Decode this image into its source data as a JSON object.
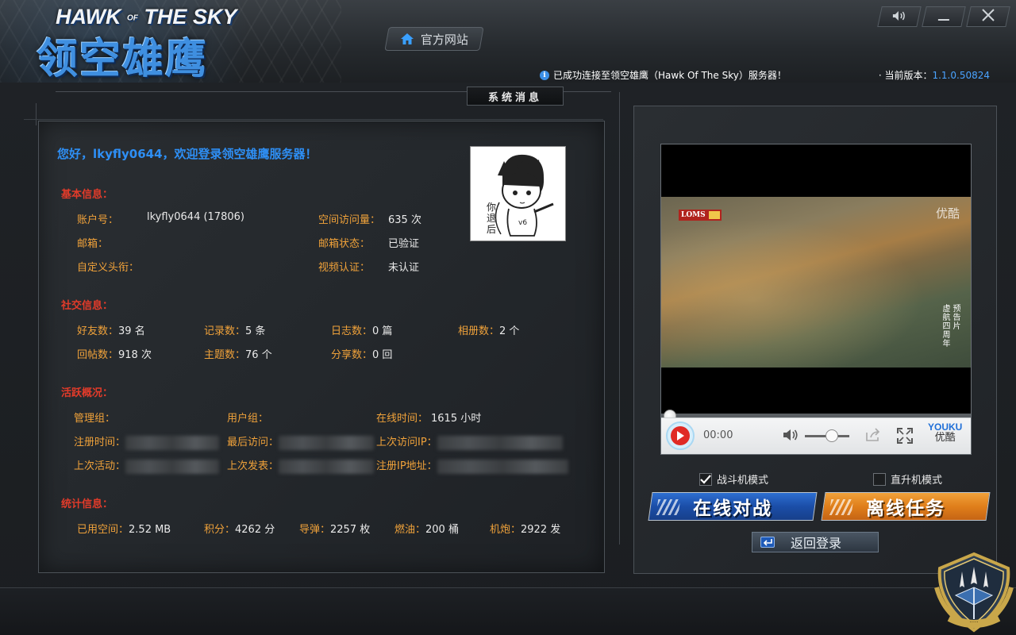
{
  "app": {
    "logo_en_part1": "HAWK",
    "logo_en_of": "OF",
    "logo_en_part2": "THE SKY",
    "logo_cn": "领空雄鹰"
  },
  "header": {
    "site_button": "官方网站",
    "status_message": "已成功连接至领空雄鹰（Hawk Of The Sky）服务器！",
    "version_label": "· 当前版本：",
    "version_value": "1.1.0.50824"
  },
  "tab": {
    "title": "系统消息"
  },
  "welcome": "您好，lkyfly0644，欢迎登录领空雄鹰服务器！",
  "basic": {
    "title": "基本信息：",
    "account_label": "账户号：",
    "account_value": "lkyfly0644 (17806)",
    "visits_label": "空间访问量：",
    "visits_value": "635 次",
    "email_label": "邮箱：",
    "email_value": "",
    "email_status_label": "邮箱状态：",
    "email_status_value": "已验证",
    "custom_avatar_label": "自定义头衔：",
    "custom_avatar_value": "",
    "video_auth_label": "视频认证：",
    "video_auth_value": "未认证"
  },
  "social": {
    "title": "社交信息：",
    "friends_label": "好友数：",
    "friends_value": "39 名",
    "records_label": "记录数：",
    "records_value": "5 条",
    "logs_label": "日志数：",
    "logs_value": "0 篇",
    "albums_label": "相册数：",
    "albums_value": "2 个",
    "replies_label": "回帖数：",
    "replies_value": "918 次",
    "topics_label": "主题数：",
    "topics_value": "76 个",
    "shares_label": "分享数：",
    "shares_value": "0 回"
  },
  "activity": {
    "title": "活跃概况：",
    "admin_group_label": "管理组：",
    "user_group_label": "用户组：",
    "online_time_label": "在线时间：",
    "online_time_value": "1615 小时",
    "reg_time_label": "注册时间：",
    "last_visit_label": "最后访问：",
    "last_ip_label": "上次访问IP：",
    "last_active_label": "上次活动：",
    "last_post_label": "上次发表：",
    "reg_ip_label": "注册IP地址："
  },
  "stats": {
    "title": "统计信息：",
    "space_label": "已用空间：",
    "space_value": "2.52 MB",
    "points_label": "积分：",
    "points_value": "4262 分",
    "missiles_label": "导弹：",
    "missiles_value": "2257 枚",
    "fuel_label": "燃油：",
    "fuel_value": "200 桶",
    "cannon_label": "机炮：",
    "cannon_value": "2922 发"
  },
  "video": {
    "badge": "LOMS",
    "watermark": "优酷",
    "caption_col1": "虚航四周年",
    "caption_col2": "预告片",
    "time": "00:00",
    "youku_en": "YOUKU",
    "youku_cn": "优酷",
    "progress_fraction": 0.0,
    "volume_fraction": 0.6
  },
  "modes": {
    "fighter_label": "战斗机模式",
    "fighter_checked": true,
    "heli_label": "直升机模式",
    "heli_checked": false
  },
  "buttons": {
    "online": "在线对战",
    "offline": "离线任务",
    "back": "返回登录"
  },
  "colors": {
    "accent_blue": "#2e8ff5",
    "section_red": "#e23b2a",
    "label_orange": "#f0a23a",
    "version_blue": "#4aa3ff"
  },
  "icons": [
    "house-icon",
    "speaker-icon",
    "minimize-icon",
    "close-icon",
    "info-icon",
    "play-icon",
    "volume-icon",
    "share-icon",
    "fullscreen-icon",
    "checkmark-icon",
    "return-icon"
  ]
}
